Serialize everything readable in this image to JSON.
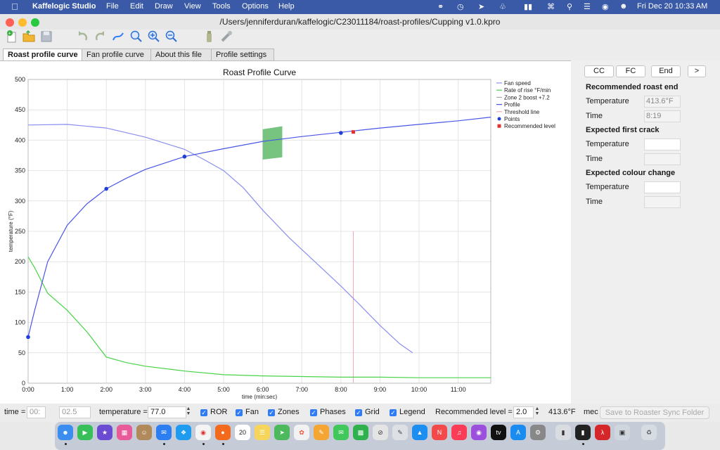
{
  "menubar": {
    "app_name": "Kaffelogic Studio",
    "items": [
      "File",
      "Edit",
      "Draw",
      "View",
      "Tools",
      "Options",
      "Help"
    ],
    "clock": "Fri Dec 20  10:33 AM"
  },
  "window": {
    "title": "/Users/jenniferduran/kaffelogic/C23011184/roast-profiles/Cupping v1.0.kpro"
  },
  "tabs": [
    {
      "label": "Roast profile curve",
      "active": true
    },
    {
      "label": "Fan profile curve",
      "active": false
    },
    {
      "label": "About this file",
      "active": false
    },
    {
      "label": "Profile settings",
      "active": false
    }
  ],
  "sidepanel": {
    "buttons": [
      "CC",
      "FC",
      "End",
      ">"
    ],
    "roast_end": {
      "heading": "Recommended roast end",
      "temperature_label": "Temperature",
      "temperature": "413.6°F",
      "time_label": "Time",
      "time": "8:19"
    },
    "first_crack": {
      "heading": "Expected first crack",
      "temperature_label": "Temperature",
      "time_label": "Time"
    },
    "colour_change": {
      "heading": "Expected colour change",
      "temperature_label": "Temperature",
      "time_label": "Time"
    }
  },
  "bottombar": {
    "time_label": "time =",
    "time_min": "00:",
    "time_sec": "02.5",
    "temperature_label": "temperature =",
    "temperature_value": "77.0",
    "checkboxes": [
      "ROR",
      "Fan",
      "Zones",
      "Phases",
      "Grid",
      "Legend"
    ],
    "recommended_label": "Recommended level =",
    "recommended_value": "2.0",
    "recommended_temp": "413.6°F",
    "truncated_label": "mec",
    "save_button": "Save to Roaster Sync Folder"
  },
  "colors": {
    "accent": "#2f7cf6",
    "profile_line": "#4a56e6",
    "fan_line": "#8a8ef0",
    "ror_line": "#47d447",
    "zone": "#5fb86a",
    "recommended": "#e2312f"
  },
  "chart_data": {
    "type": "line",
    "title": "Roast Profile Curve",
    "xlabel": "time (min:sec)",
    "ylabel": "temperature (°F)",
    "xlim": [
      0,
      710
    ],
    "ylim": [
      0,
      500
    ],
    "x_ticks": [
      "0:00",
      "1:00",
      "2:00",
      "3:00",
      "4:00",
      "5:00",
      "6:00",
      "7:00",
      "8:00",
      "9:00",
      "10:00",
      "11:00"
    ],
    "y_ticks": [
      0,
      50,
      100,
      150,
      200,
      250,
      300,
      350,
      400,
      450,
      500
    ],
    "grid": true,
    "legend_position": "top-right",
    "legend": [
      "Fan speed",
      "Rate of rise °F/min",
      "Zone 2 boost +7.2",
      "Profile",
      "Threshold line",
      "Points",
      "Recommended level"
    ],
    "series": [
      {
        "name": "Fan speed",
        "x": [
          0,
          60,
          120,
          180,
          240,
          270,
          300,
          330,
          360,
          400,
          450,
          480,
          510,
          540,
          570,
          590
        ],
        "y": [
          425,
          426,
          420,
          405,
          385,
          368,
          350,
          322,
          285,
          240,
          190,
          160,
          128,
          95,
          65,
          50
        ]
      },
      {
        "name": "Rate of rise °F/min",
        "x": [
          0,
          10,
          30,
          60,
          90,
          120,
          150,
          180,
          240,
          300,
          360,
          420,
          480,
          540,
          600,
          710
        ],
        "y": [
          208,
          190,
          148,
          120,
          85,
          43,
          34,
          28,
          20,
          14,
          12,
          11,
          10,
          10,
          9,
          9
        ]
      },
      {
        "name": "Profile",
        "x": [
          0,
          10,
          30,
          60,
          90,
          120,
          150,
          180,
          240,
          300,
          360,
          420,
          480,
          540,
          600,
          660,
          710
        ],
        "y": [
          76,
          120,
          200,
          260,
          295,
          320,
          337,
          352,
          373,
          386,
          398,
          406,
          413,
          420,
          426,
          432,
          438
        ]
      }
    ],
    "points": [
      {
        "x": 0,
        "y": 76
      },
      {
        "x": 120,
        "y": 320
      },
      {
        "x": 240,
        "y": 373
      },
      {
        "x": 480,
        "y": 412
      }
    ],
    "recommended_point": {
      "x": 499,
      "y": 413.6
    },
    "threshold_line": {
      "x": 499,
      "y_from": 0,
      "y_to": 250
    },
    "zone": {
      "x_from": 360,
      "x_to": 390,
      "y_bottom_from": 368,
      "y_bottom_to": 372,
      "y_top_from": 418,
      "y_top_to": 423
    }
  }
}
